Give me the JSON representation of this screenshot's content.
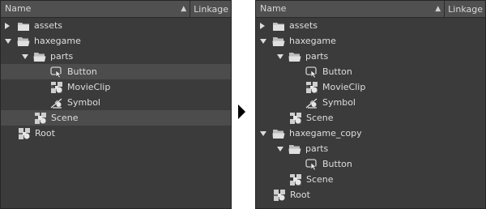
{
  "header": {
    "name_label": "Name",
    "sort_glyph": "▲",
    "linkage_label": "Linkage"
  },
  "left": {
    "assets": "assets",
    "haxegame": "haxegame",
    "parts": "parts",
    "button": "Button",
    "movieclip": "MovieClip",
    "symbol": "Symbol",
    "scene": "Scene",
    "root": "Root"
  },
  "right": {
    "assets": "assets",
    "haxegame": "haxegame",
    "parts": "parts",
    "button": "Button",
    "movieclip": "MovieClip",
    "symbol": "Symbol",
    "scene": "Scene",
    "haxegame_copy": "haxegame_copy",
    "parts_copy": "parts",
    "button_copy": "Button",
    "scene_copy": "Scene",
    "root": "Root"
  },
  "icons": [
    "folder-icon",
    "button-symbol-icon",
    "movieclip-icon",
    "graphic-symbol-icon",
    "scene-icon",
    "root-icon"
  ],
  "colors": {
    "panel_bg": "#3b3b3b",
    "header_bg": "#505050",
    "selected_row": "#4c4c4c",
    "text": "#dedede"
  }
}
